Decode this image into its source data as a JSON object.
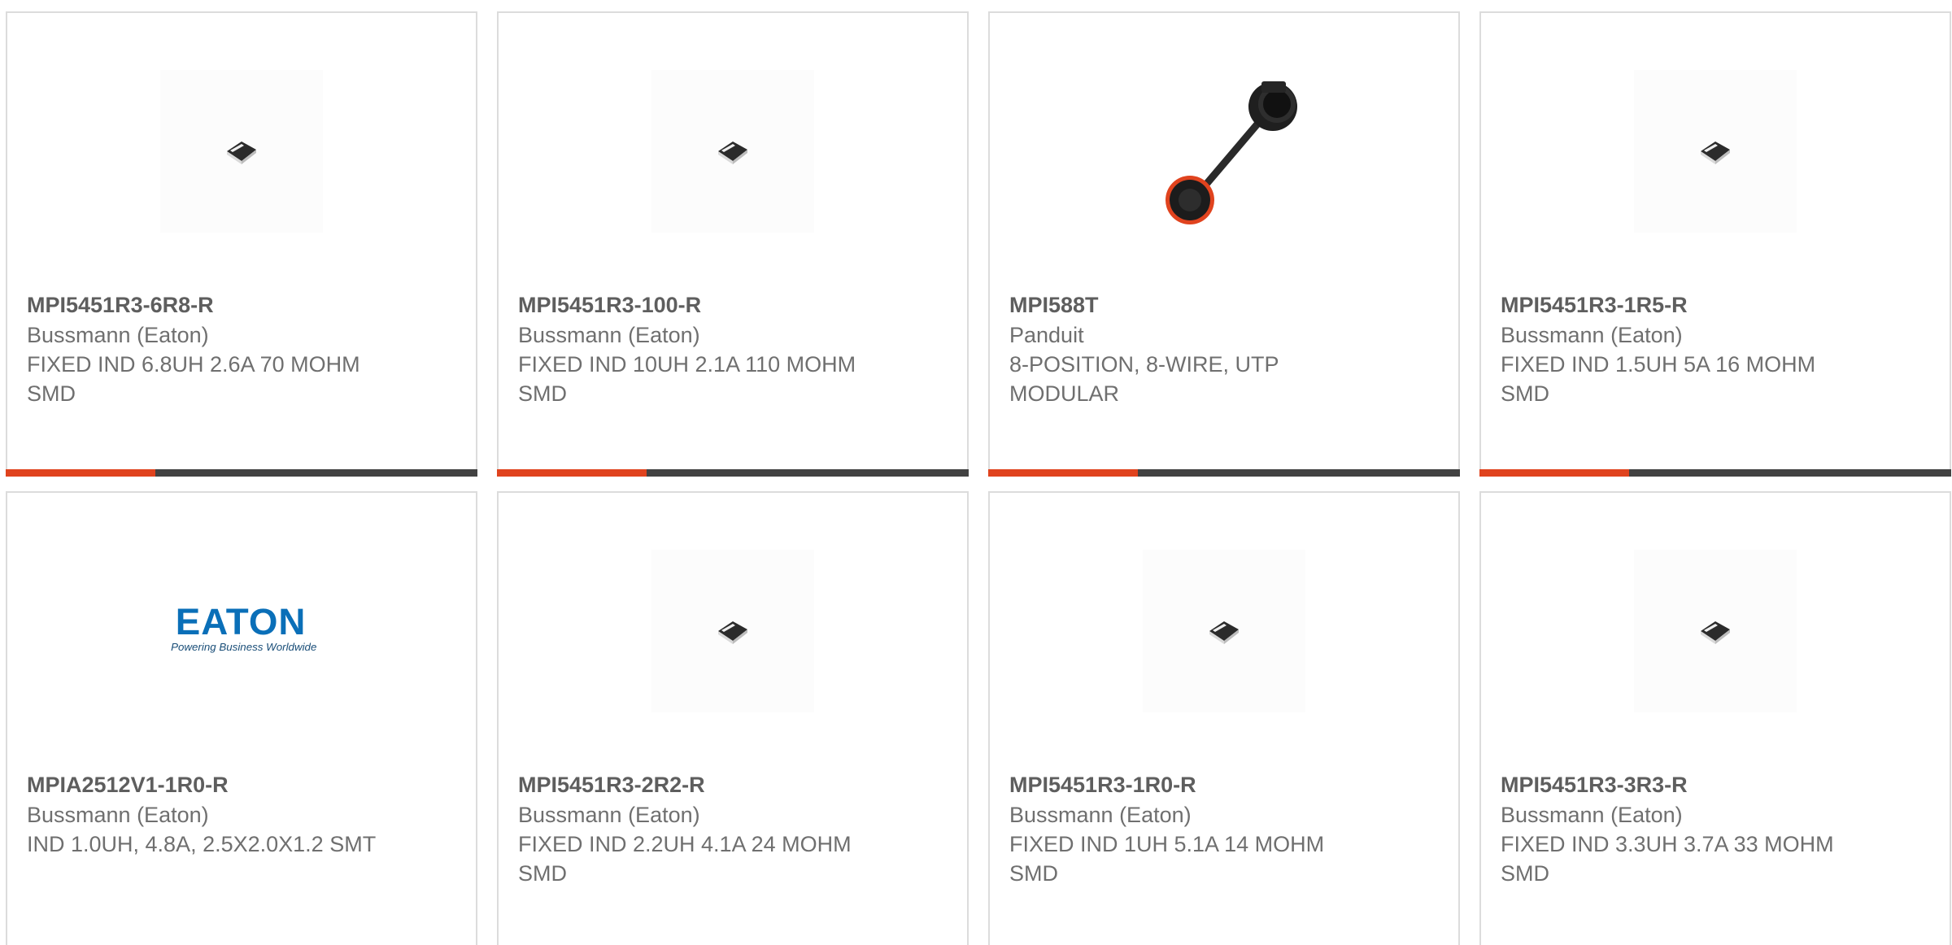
{
  "colors": {
    "accent": "#e0431e",
    "bar_dark": "#424242",
    "text": "#6f6f6f",
    "border": "#dcdcdc",
    "eaton_blue": "#0a6fb8"
  },
  "products": [
    {
      "part_number": "MPI5451R3-6R8-R",
      "manufacturer": "Bussmann (Eaton)",
      "description": "FIXED IND 6.8UH 2.6A 70 MOHM SMD",
      "image": "smd-inductor-chip"
    },
    {
      "part_number": "MPI5451R3-100-R",
      "manufacturer": "Bussmann (Eaton)",
      "description": "FIXED IND 10UH 2.1A 110 MOHM SMD",
      "image": "smd-inductor-chip"
    },
    {
      "part_number": "MPI588T",
      "manufacturer": "Panduit",
      "description": "8-POSITION, 8-WIRE, UTP MODULAR",
      "image": "modular-jack-cable"
    },
    {
      "part_number": "MPI5451R3-1R5-R",
      "manufacturer": "Bussmann (Eaton)",
      "description": "FIXED IND 1.5UH 5A 16 MOHM SMD",
      "image": "smd-inductor-chip"
    },
    {
      "part_number": "MPIA2512V1-1R0-R",
      "manufacturer": "Bussmann (Eaton)",
      "description": "IND 1.0UH, 4.8A, 2.5X2.0X1.2 SMT",
      "image": "eaton-logo",
      "logo_text": "EATON",
      "logo_tagline": "Powering Business Worldwide"
    },
    {
      "part_number": "MPI5451R3-2R2-R",
      "manufacturer": "Bussmann (Eaton)",
      "description": "FIXED IND 2.2UH 4.1A 24 MOHM SMD",
      "image": "smd-inductor-chip"
    },
    {
      "part_number": "MPI5451R3-1R0-R",
      "manufacturer": "Bussmann (Eaton)",
      "description": "FIXED IND 1UH 5.1A 14 MOHM SMD",
      "image": "smd-inductor-chip"
    },
    {
      "part_number": "MPI5451R3-3R3-R",
      "manufacturer": "Bussmann (Eaton)",
      "description": "FIXED IND 3.3UH 3.7A 33 MOHM SMD",
      "image": "smd-inductor-chip"
    }
  ]
}
